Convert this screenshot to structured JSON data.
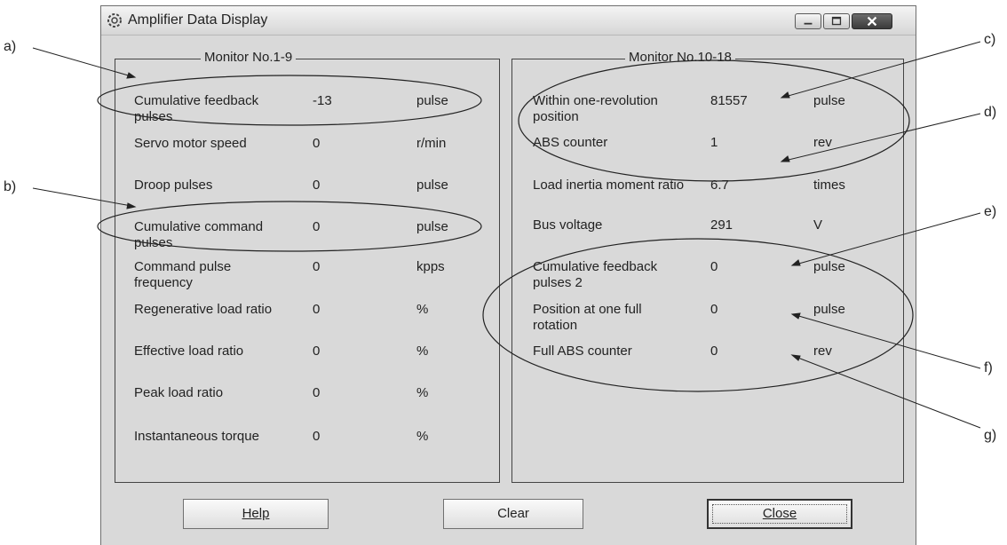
{
  "window": {
    "title": "Amplifier Data Display",
    "icons": {
      "app": "gear-icon",
      "minimize": "minimize-icon",
      "maximize": "maximize-icon",
      "close": "close-icon"
    }
  },
  "left_panel": {
    "title": "Monitor No.1-9",
    "rows": [
      {
        "label": "Cumulative feedback pulses",
        "value": "-13",
        "unit": "pulse"
      },
      {
        "label": "Servo motor speed",
        "value": "0",
        "unit": "r/min"
      },
      {
        "label": "Droop pulses",
        "value": "0",
        "unit": "pulse"
      },
      {
        "label": "Cumulative command pulses",
        "value": "0",
        "unit": "pulse"
      },
      {
        "label": "Command pulse frequency",
        "value": "0",
        "unit": "kpps"
      },
      {
        "label": "Regenerative load ratio",
        "value": "0",
        "unit": "%"
      },
      {
        "label": "Effective load ratio",
        "value": "0",
        "unit": "%"
      },
      {
        "label": "Peak load ratio",
        "value": "0",
        "unit": "%"
      },
      {
        "label": "Instantaneous torque",
        "value": "0",
        "unit": "%"
      }
    ]
  },
  "right_panel": {
    "title": "Monitor No.10-18",
    "rows": [
      {
        "label": "Within one-revolution position",
        "value": "81557",
        "unit": "pulse"
      },
      {
        "label": "ABS counter",
        "value": "1",
        "unit": "rev"
      },
      {
        "label": "Load inertia moment ratio",
        "value": "6.7",
        "unit": "times"
      },
      {
        "label": "Bus voltage",
        "value": "291",
        "unit": "V"
      },
      {
        "label": "Cumulative feedback pulses 2",
        "value": "0",
        "unit": "pulse"
      },
      {
        "label": "Position at one full rotation",
        "value": "0",
        "unit": "pulse"
      },
      {
        "label": "Full ABS counter",
        "value": "0",
        "unit": "rev"
      }
    ]
  },
  "buttons": {
    "help": "Help",
    "clear": "Clear",
    "close": "Close"
  },
  "callouts": [
    "a)",
    "b)",
    "c)",
    "d)",
    "e)",
    "f)",
    "g)"
  ]
}
